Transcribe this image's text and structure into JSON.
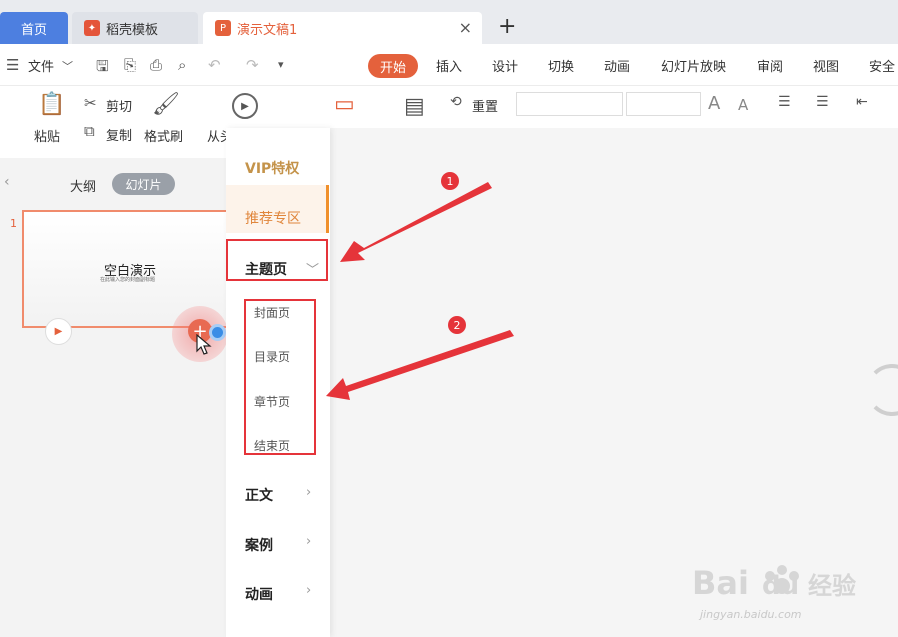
{
  "tabs": {
    "home": "首页",
    "template": "稻壳模板",
    "doc": "演示文稿1",
    "add": "+",
    "close": "×"
  },
  "menu": {
    "file": "文件",
    "start": "开始",
    "items": [
      "插入",
      "设计",
      "切换",
      "动画",
      "幻灯片放映",
      "审阅",
      "视图",
      "安全"
    ]
  },
  "ribbon": {
    "paste": "粘贴",
    "cut": "剪切",
    "copy": "复制",
    "format_painter": "格式刷",
    "from_start": "从头",
    "reset": "重置",
    "font_grow": "A",
    "font_shrink": "A"
  },
  "left_panel": {
    "outline": "大纲",
    "slides": "幻灯片",
    "slide_number": "1",
    "slide_title": "空白演示",
    "slide_subtitle": "在此输入您的封面副标题"
  },
  "dropdown": {
    "vip": "VIP特权",
    "recommended": "推荐专区",
    "theme": "主题页",
    "theme_sub": [
      "封面页",
      "目录页",
      "章节页",
      "结束页"
    ],
    "body": "正文",
    "cases": "案例",
    "animation": "动画"
  },
  "annotations": {
    "badge1": "1",
    "badge2": "2",
    "color": "#e5343a"
  },
  "watermark": {
    "line2": "jingyan.baidu.com"
  },
  "colors": {
    "accent": "#e4613c",
    "home_tab": "#4d7fe0",
    "vip": "#c4934a",
    "recommended": "#e0863c"
  }
}
